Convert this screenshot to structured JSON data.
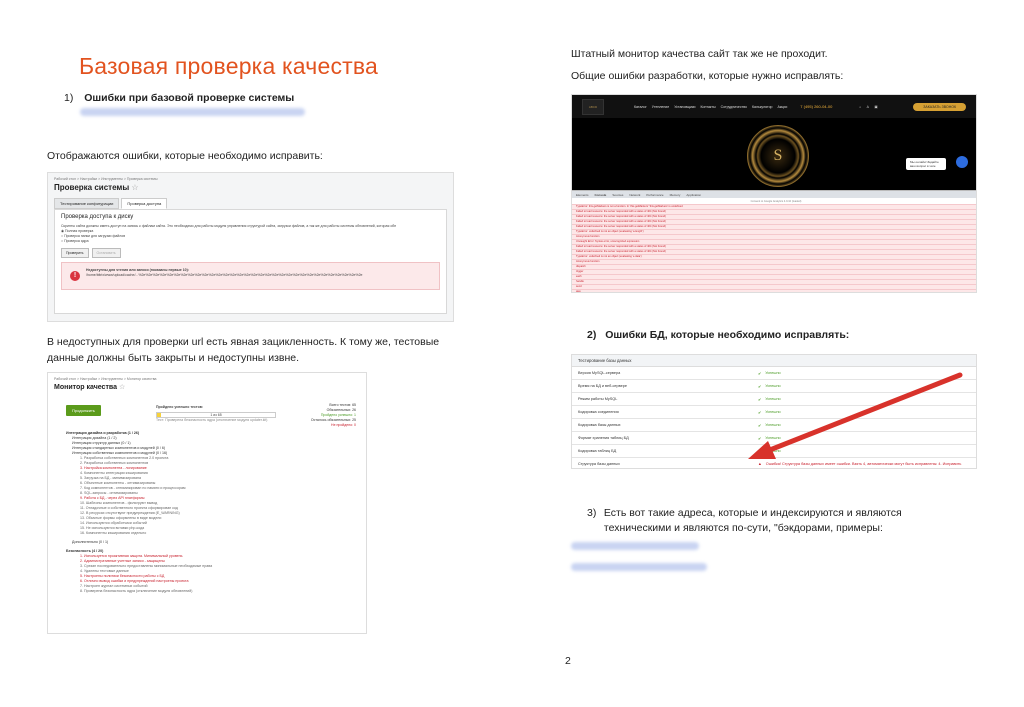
{
  "left": {
    "title": "Базовая проверка качества",
    "item1": {
      "num": "1)",
      "text": "Ошибки при базовой проверке системы"
    },
    "para1": "Отображаются ошибки, которые необходимо исправить:",
    "para2": "В недоступных для проверки url есть явная зацикленность. К тому же, тестовые данные должны быть закрыты и недоступны извне."
  },
  "shot1": {
    "breadcrumb": "Рабочий стол > Настройки > Инструменты > Проверка системы",
    "title": "Проверка системы",
    "tabs": [
      "Тестирование конфигурации",
      "Проверка доступа"
    ],
    "panel_title": "Проверка доступа к диску",
    "note": "Скрипты сайта должны иметь доступ на запись к файлам сайта. Это необходимо для работы модуля управления структурой сайта, загрузки файлов, а так же для работы системы обновлений, которая обн",
    "options": [
      "Полная проверка",
      "Проверка папки для загрузки файлов",
      "Проверка ядра"
    ],
    "buttons": [
      "Проверить",
      "Остановить"
    ],
    "error_icon": "!",
    "error_title": "Недоступны для чтения или записи (показаны первые 10):",
    "error_path": "/home/bitrix/www/upload/cache/...%2e%2e%2e%2e%2e%2e%2e%2e%2e%2e%2e%2e%2e%2e%2e%2e%2e%2e%2e%2e%2e%2e%2e%2e%2e%2e%2e%2e%2e%2e%2e%2e"
  },
  "shot2": {
    "breadcrumb": "Рабочий стол > Настройки > Инструменты > Монитор качества",
    "title": "Монитор качества",
    "button": "Продолжить",
    "progress_label": "Пройдено успешно тестов:",
    "progress_value": "1 из 65",
    "progress_fraction": 0.03,
    "progress_note": "Тест: Проверена безопасность ядра (отключение модуля updater.kit)",
    "stats": [
      "Всего тестов: 65",
      "Обязательных: 26",
      "Пройдено успешно: 1",
      "Осталось обязательных: 25",
      "Не пройдено: 0"
    ],
    "tree": [
      {
        "t": "Интеграция дизайна и разработка (1 / 26)",
        "c": "lvl0"
      },
      {
        "t": "Интеграция дизайна (1 / 2)",
        "c": "lvl1"
      },
      {
        "t": "Интеграция структур данных (0 / 1)",
        "c": "lvl1"
      },
      {
        "t": "Интеграция стандартных компонентов и модулей (0 / 6)",
        "c": "lvl1"
      },
      {
        "t": "Интеграция собственных компонентов и модулей (0 / 16)",
        "c": "lvl1"
      },
      {
        "t": "1. Разработка собственных компонентов 2.0 проекта",
        "c": "lvl2"
      },
      {
        "t": "2. Разработка собственных компонентов",
        "c": "lvl2"
      },
      {
        "t": "3. Настройка компонента - логирование",
        "c": "lvl2 bad"
      },
      {
        "t": "4. Компоненты интеграции кэширования",
        "c": "lvl2"
      },
      {
        "t": "5. Загрузка на БД - минимизирована",
        "c": "lvl2"
      },
      {
        "t": "6. Объектные компоненты - оптимизированы",
        "c": "lvl2"
      },
      {
        "t": "7. Код компонентов - оптимизирован по памяти и процессорам",
        "c": "lvl2"
      },
      {
        "t": "8. SQL-запросы - оптимизированы",
        "c": "lvl2"
      },
      {
        "t": "9. Работа с БД - через API платформы",
        "c": "lvl2 bad"
      },
      {
        "t": "10. Шаблоны компонентов - фильтруют вывод",
        "c": "lvl2"
      },
      {
        "t": "11. Отладочные и собственного проекта сформирован код",
        "c": "lvl2"
      },
      {
        "t": "12. В ресурсах отсутствуют предупреждения (E_WARNING)",
        "c": "lvl2"
      },
      {
        "t": "13. Обычные формы оформлены в виде модели",
        "c": "lvl2"
      },
      {
        "t": "14. Используются обработчики событий",
        "c": "lvl2"
      },
      {
        "t": "15. Не используются вставки php-кода",
        "c": "lvl2"
      },
      {
        "t": "16. Компоненты кэширования отдельно",
        "c": "lvl2"
      },
      {
        "t": "",
        "c": "spacer"
      },
      {
        "t": "Дополнительно (0 / 1)",
        "c": "lvl1"
      },
      {
        "t": "",
        "c": "spacer"
      },
      {
        "t": "Безопасность (4 / 20)",
        "c": "lvl0"
      },
      {
        "t": "1. Используется проактивная защита. Минимальный уровень",
        "c": "lvl2 bad"
      },
      {
        "t": "2. Административные учетные записи - защищены",
        "c": "lvl2 bad"
      },
      {
        "t": "3. Срезан последовательно предоставлены минимальные необходимые права",
        "c": "lvl2"
      },
      {
        "t": "4. Удалены тестовые данные",
        "c": "lvl2"
      },
      {
        "t": "5. Настроены политики безопасности работы с БД",
        "c": "lvl2 bad"
      },
      {
        "t": "6. Отлично вывод ошибки и предупреждений настроены проекта",
        "c": "lvl2 bad"
      },
      {
        "t": "7. Настроен журнал системных событий",
        "c": "lvl2"
      },
      {
        "t": "8. Проверена безопасность ядра (отключение модуля обновлений)",
        "c": "lvl2"
      }
    ]
  },
  "right": {
    "para_top": "Штатный монитор качества сайт так же не проходит.",
    "para_errors": "Общие ошибки разработки, которые нужно исправлять:",
    "item2": {
      "num": "2)",
      "text": "Ошибки БД, которые необходимо исправлять:"
    },
    "item3": {
      "num": "3)",
      "text": "Есть вот такие адреса, которые и индексируются и являются техническими и являются по-сути, \"бэкдорами, примеры:"
    }
  },
  "shot3": {
    "logo": "ABCD",
    "nav": [
      "Каталог",
      "Утепление",
      "Установщики",
      "Контакты",
      "Сотрудничество",
      "Калькулятор",
      "Акции"
    ],
    "phone": "7 (495) 260-04-00",
    "cta": "ЗАКАЗАТЬ ЗВОНОК",
    "medallion": "S",
    "chat": "Мы онлайн! Задайте ваш вопрос в чате",
    "devtools": [
      "Elements",
      "Console",
      "Sources",
      "Network",
      "Performance",
      "Memory",
      "Application"
    ],
    "console_rows": [
      {
        "t": "Consent to Google Analytics 4.9.10 (loaded)",
        "c": "center"
      },
      {
        "t": "TypeError: this.getMarkers is not a function. In 'this.getMarkers' 'this.getMarkers' is undefined",
        "c": ""
      },
      {
        "t": "Failed to load resource: the server responded with a status of 404 (Not Found)",
        "c": ""
      },
      {
        "t": "Failed to load resource: the server responded with a status of 404 (Not Found)",
        "c": ""
      },
      {
        "t": "Failed to load resource: the server responded with a status of 404 (Not Found)",
        "c": ""
      },
      {
        "t": "Failed to load resource: the server responded with a status of 404 (Not Found)",
        "c": ""
      },
      {
        "t": "TypeError: undefined is not an object (evaluating 'a.length')",
        "c": ""
      },
      {
        "t": "  Anonymous function",
        "c": ""
      },
      {
        "t": "Uncaught Error: Syntax error, unrecognized expression",
        "c": ""
      },
      {
        "t": "Failed to load resource: the server responded with a status of 404 (Not Found)",
        "c": ""
      },
      {
        "t": "Failed to load resource: the server responded with a status of 404 (Not Found)",
        "c": ""
      },
      {
        "t": "TypeError: undefined is not an object (evaluating 'e.data')",
        "c": ""
      },
      {
        "t": "  Anonymous function",
        "c": ""
      },
      {
        "t": "  dispatch",
        "c": ""
      },
      {
        "t": "  trigger",
        "c": ""
      },
      {
        "t": "  each",
        "c": ""
      },
      {
        "t": "  handle",
        "c": ""
      },
      {
        "t": "  send",
        "c": ""
      },
      {
        "t": "  ajax",
        "c": ""
      },
      {
        "t": "  (anonymous function)",
        "c": ""
      }
    ]
  },
  "shot4": {
    "header": "Тестирование базы данных",
    "rows": [
      {
        "k": "Версия MySQL-сервера",
        "v": "Успешно",
        "s": "ok"
      },
      {
        "k": "Время на БД и веб-сервере",
        "v": "Успешно",
        "s": "ok"
      },
      {
        "k": "Режим работы MySQL",
        "v": "Успешно",
        "s": "ok"
      },
      {
        "k": "Кодировка соединения",
        "v": "Успешно",
        "s": "ok"
      },
      {
        "k": "Кодировка базы данных",
        "v": "Успешно",
        "s": "ok"
      },
      {
        "k": "Формат хранения таблиц БД",
        "v": "Успешно",
        "s": "ok"
      },
      {
        "k": "Кодировка таблиц БД",
        "v": "Успешно",
        "s": "ok"
      },
      {
        "k": "Структура базы данных",
        "v": "Ошибка! Структура базы данных имеет ошибки. Взять 4, автоматически могут быть исправлены: 4. Исправить",
        "s": "err"
      }
    ]
  },
  "page_number": "2",
  "colors": {
    "title_orange": "#e2531f",
    "error_red": "#c8202d",
    "ok_green": "#4b9b25",
    "arrow_red": "#d8322b"
  }
}
